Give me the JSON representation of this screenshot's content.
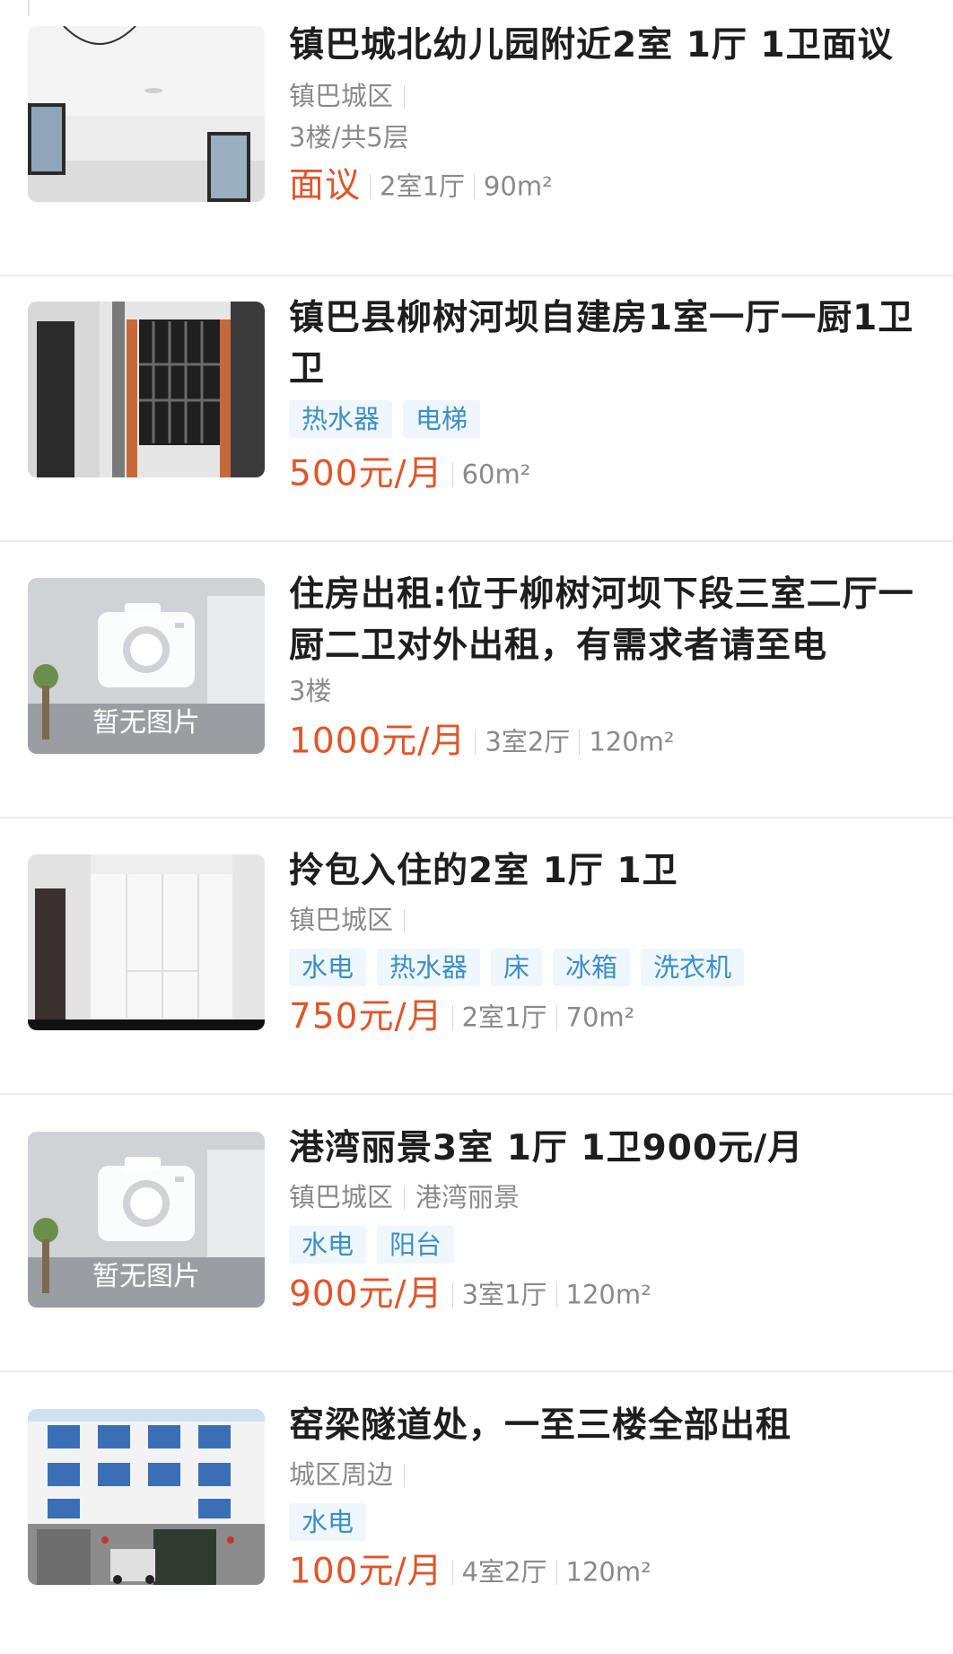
{
  "listings": [
    {
      "title": "镇巴城北幼儿园附近2室 1厅 1卫面议",
      "location": [
        "镇巴城区",
        ""
      ],
      "floor": "3楼/共5层",
      "tags": [],
      "price": "面议",
      "specs": [
        "2室1厅",
        "90m²"
      ],
      "thumb": "room-window-photo"
    },
    {
      "title": "镇巴县柳树河坝自建房1室一厅一厨1卫卫",
      "location": [],
      "floor": "",
      "tags": [
        "热水器",
        "电梯"
      ],
      "price": "500元/月",
      "specs": [
        "60m²"
      ],
      "thumb": "barred-window-photo"
    },
    {
      "title": "住房出租:位于柳树河坝下段三室二厅一厨二卫对外出租，有需求者请至电",
      "location": [],
      "floor": "3楼",
      "tags": [],
      "price": "1000元/月",
      "specs": [
        "3室2厅",
        "120m²"
      ],
      "thumb": "no-image-placeholder",
      "placeholder_text": "暂无图片"
    },
    {
      "title": "拎包入住的2室 1厅 1卫",
      "location": [
        "镇巴城区",
        ""
      ],
      "floor": "",
      "tags": [
        "水电",
        "热水器",
        "床",
        "冰箱",
        "洗衣机"
      ],
      "price": "750元/月",
      "specs": [
        "2室1厅",
        "70m²"
      ],
      "thumb": "wardrobe-room-photo"
    },
    {
      "title": "港湾丽景3室 1厅 1卫900元/月",
      "location": [
        "镇巴城区",
        "港湾丽景"
      ],
      "floor": "",
      "tags": [
        "水电",
        "阳台"
      ],
      "price": "900元/月",
      "specs": [
        "3室1厅",
        "120m²"
      ],
      "thumb": "no-image-placeholder",
      "placeholder_text": "暂无图片"
    },
    {
      "title": "窑梁隧道处，一至三楼全部出租",
      "location": [
        "城区周边",
        ""
      ],
      "floor": "",
      "tags": [
        "水电"
      ],
      "price": "100元/月",
      "specs": [
        "4室2厅",
        "120m²"
      ],
      "thumb": "building-facade-photo"
    }
  ],
  "colors": {
    "price": "#e0562a",
    "tag_text": "#3d8ec9",
    "tag_bg": "#eef7fc",
    "meta_text": "#8a8a8a"
  }
}
